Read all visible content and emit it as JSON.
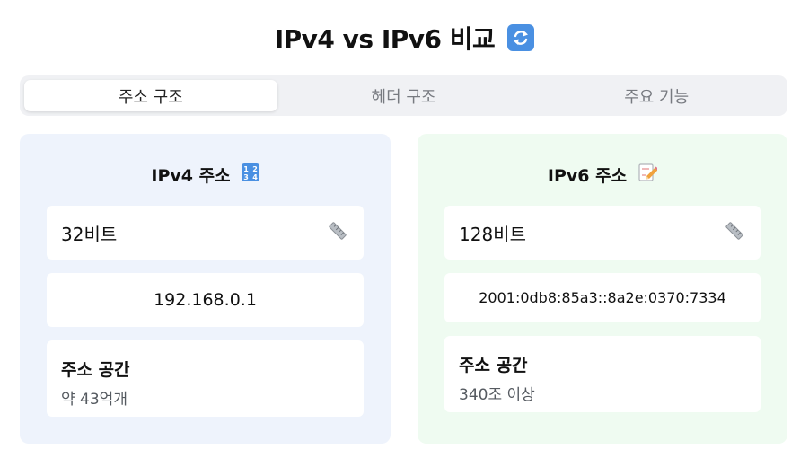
{
  "header": {
    "title": "IPv4 vs IPv6 비교",
    "icon": "refresh-icon"
  },
  "tabs": [
    {
      "label": "주소 구조",
      "active": true
    },
    {
      "label": "헤더 구조",
      "active": false
    },
    {
      "label": "주요 기능",
      "active": false
    }
  ],
  "ipv4": {
    "title": "IPv4 주소",
    "title_icon": "numbers-icon",
    "bits": "32비트",
    "bits_icon": "ruler-icon",
    "example": "192.168.0.1",
    "space_label": "주소 공간",
    "space_value": "약 43억개"
  },
  "ipv6": {
    "title": "IPv6 주소",
    "title_icon": "memo-icon",
    "bits": "128비트",
    "bits_icon": "ruler-icon",
    "example": "2001:0db8:85a3::8a2e:0370:7334",
    "space_label": "주소 공간",
    "space_value": "340조 이상"
  },
  "colors": {
    "ipv4_card": "#eef3fc",
    "ipv6_card": "#effbf1",
    "accent": "#4a90e2"
  }
}
